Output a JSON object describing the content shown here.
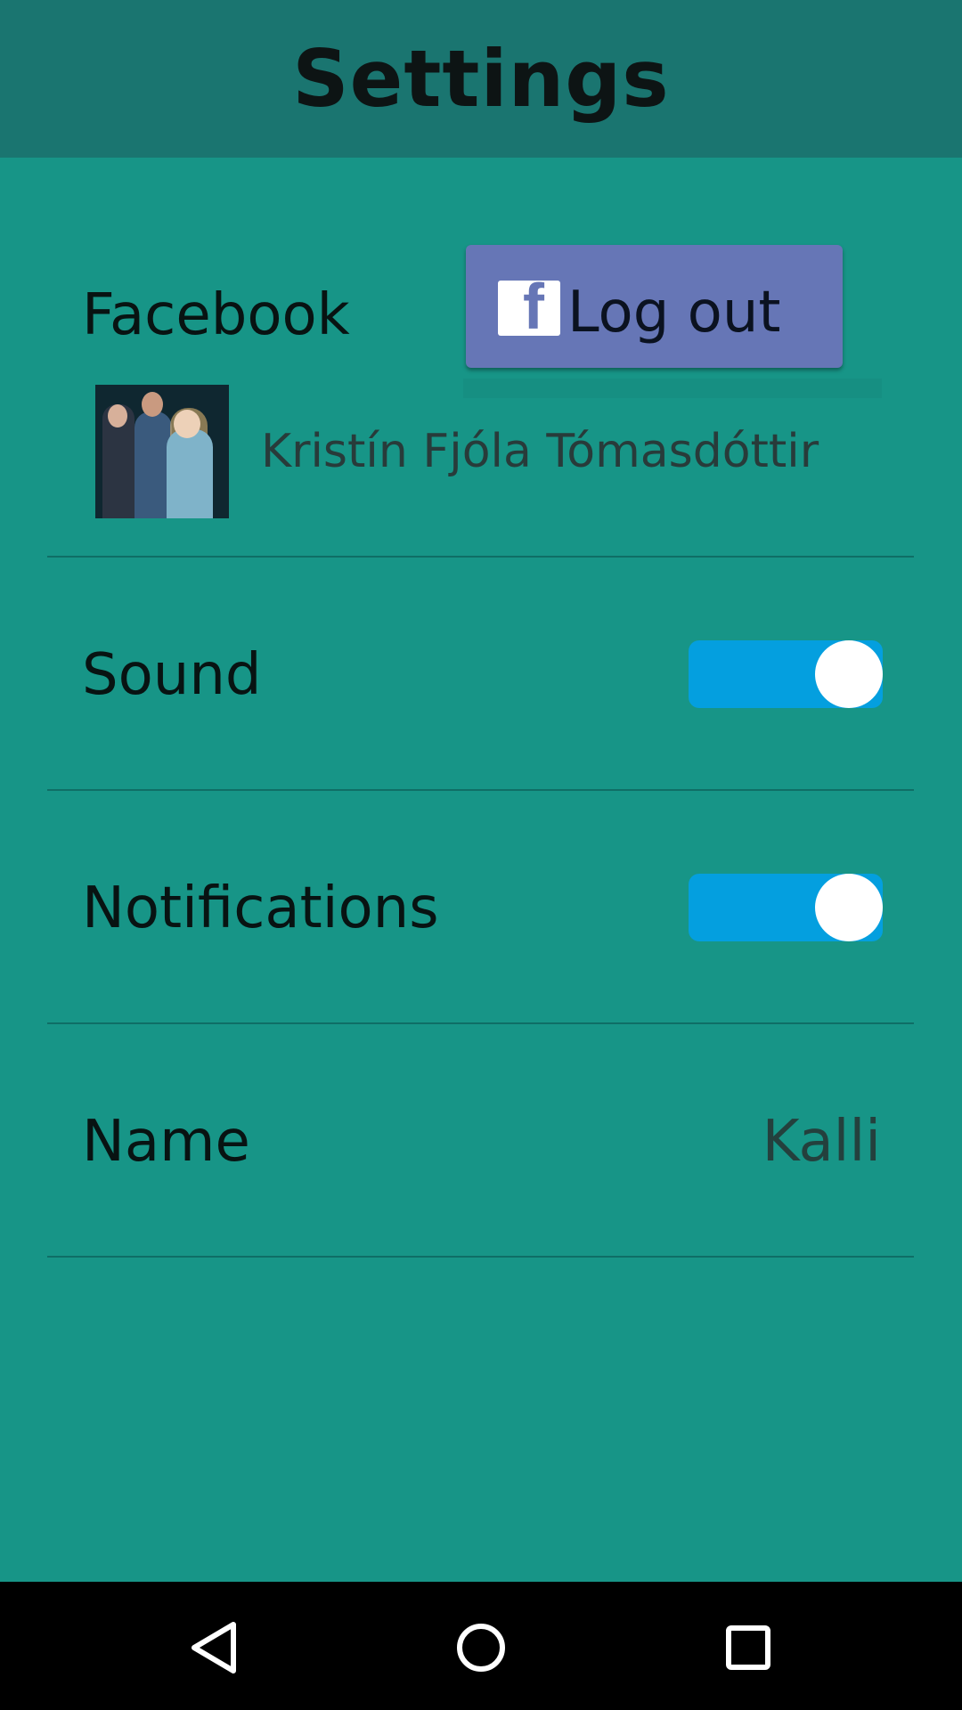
{
  "header": {
    "title": "Settings"
  },
  "facebook": {
    "label": "Facebook",
    "logout_label": "Log out",
    "user_name": "Kristín Fjóla Tómasdóttir",
    "button_color": "#6676b6"
  },
  "sound": {
    "label": "Sound",
    "enabled": true
  },
  "notifications": {
    "label": "Notifications",
    "enabled": true
  },
  "name": {
    "label": "Name",
    "value": "Kalli"
  },
  "colors": {
    "background": "#179587",
    "header": "#1a7570",
    "toggle_on": "#049fdf"
  },
  "navbar": {
    "icons": [
      "back-icon",
      "home-icon",
      "recent-apps-icon"
    ]
  }
}
